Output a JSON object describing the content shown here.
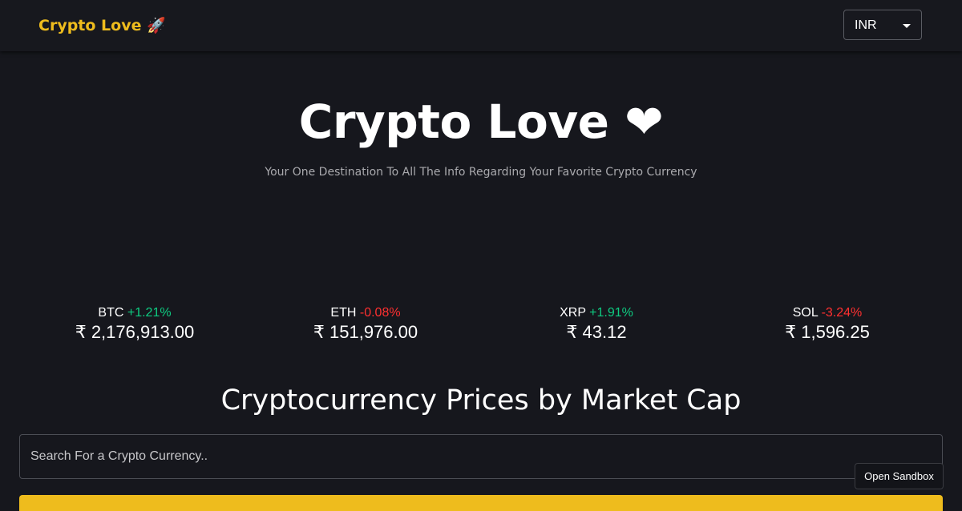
{
  "navbar": {
    "brand": "Crypto Love 🚀",
    "currency": {
      "selected": "INR",
      "icon": "chevron-down-icon"
    }
  },
  "hero": {
    "title": "Crypto Love ❤",
    "subtitle": "Your One Destination To All The Info Regarding Your Favorite Crypto Currency"
  },
  "trending": [
    {
      "symbol": "BTC",
      "change": "+1.21%",
      "direction": "up",
      "price": "₹ 2,176,913.00"
    },
    {
      "symbol": "ETH",
      "change": "-0.08%",
      "direction": "down",
      "price": "₹ 151,976.00"
    },
    {
      "symbol": "XRP",
      "change": "+1.91%",
      "direction": "up",
      "price": "₹ 43.12"
    },
    {
      "symbol": "SOL",
      "change": "-3.24%",
      "direction": "down",
      "price": "₹ 1,596.25"
    }
  ],
  "market": {
    "title": "Cryptocurrency Prices by Market Cap",
    "search_placeholder": "Search For a Crypto Currency..",
    "search_value": ""
  },
  "sandbox": {
    "label": "Open Sandbox"
  },
  "colors": {
    "background": "#16171d",
    "accent": "#eebc1d",
    "positive": "#0ecb81",
    "negative": "#ff3030"
  }
}
